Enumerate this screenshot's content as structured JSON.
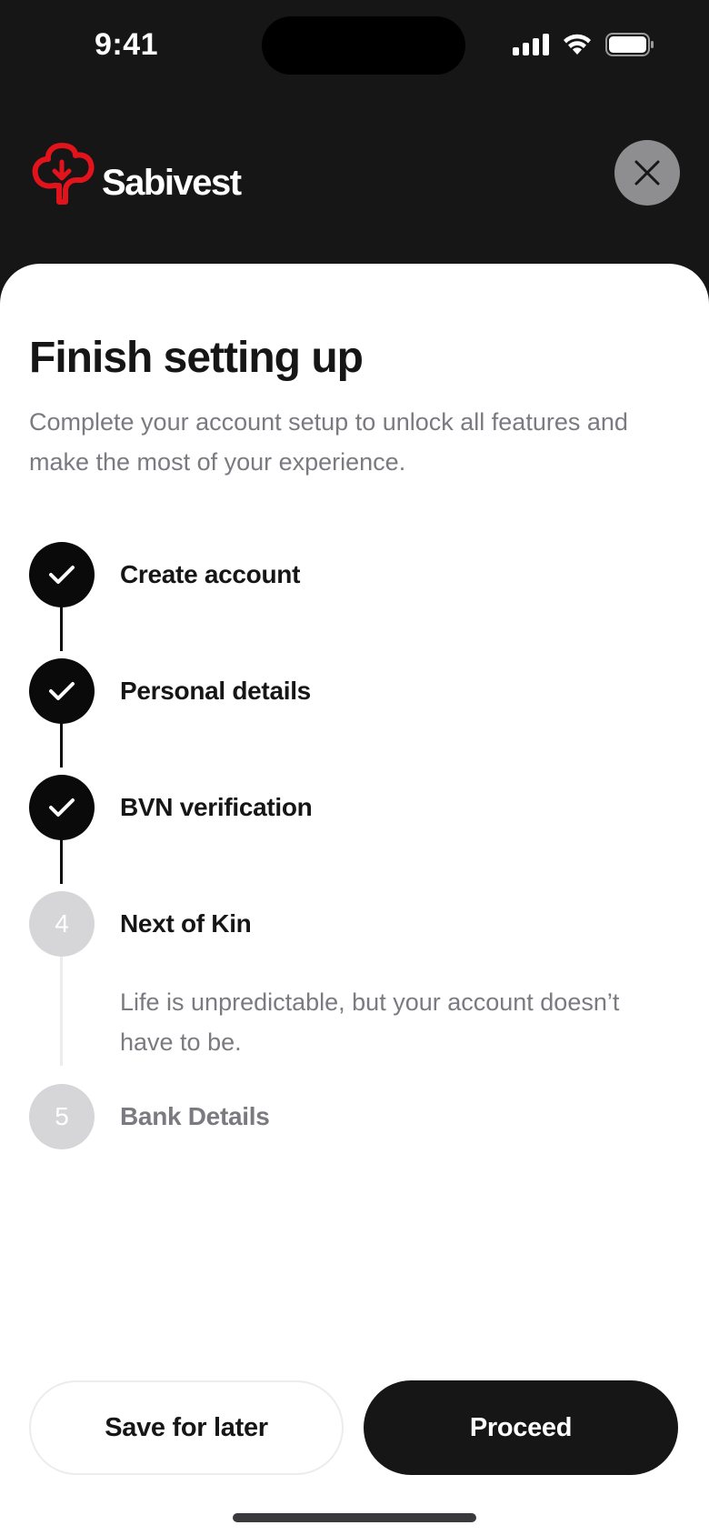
{
  "status_bar": {
    "time": "9:41"
  },
  "header": {
    "brand_name": "Sabivest",
    "brand_color": "#e3131b"
  },
  "sheet": {
    "title": "Finish setting up",
    "subtitle": "Complete your account setup to unlock all features and make the most of your experience."
  },
  "steps": [
    {
      "label": "Create account",
      "status": "done",
      "icon": "check-icon"
    },
    {
      "label": "Personal details",
      "status": "done",
      "icon": "check-icon"
    },
    {
      "label": "BVN verification",
      "status": "done",
      "icon": "check-icon"
    },
    {
      "number": "4",
      "label": "Next of Kin",
      "status": "current",
      "description": "Life is unpredictable, but your account doesn’t have to be."
    },
    {
      "number": "5",
      "label": "Bank Details",
      "status": "pending"
    }
  ],
  "actions": {
    "save_label": "Save for later",
    "proceed_label": "Proceed"
  }
}
